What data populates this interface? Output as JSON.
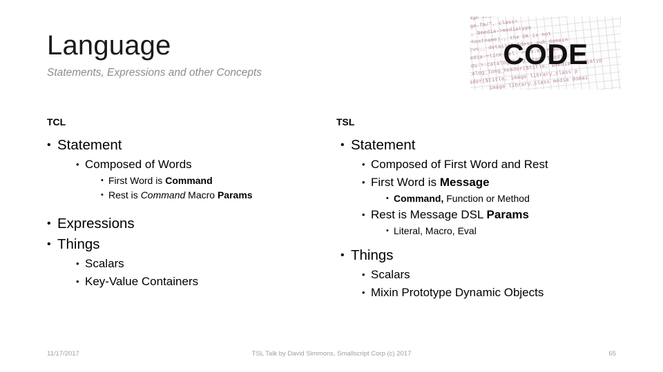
{
  "slide": {
    "title": "Language",
    "subtitle": "Statements, Expressions and other Concepts"
  },
  "code_image": {
    "word": "CODE",
    "alt": "code-collage-image",
    "code_lines": [
      ", new image tr_",
      "ctp://page.fm/\", class=",
      "r($title, $media->mediatype",
      "$media->hostname)., the OK is not",
      "es and cus__ details\",$desc_sub_domain",
      "type, media->link-rel  =-ss.main.edu-.",
      ".main.edu->-catalog_long_head, $media->med",
      "stn_catalog_long_header($title, $media->mediatyp",
      "    header($title, image library_class p",
      "            image library_class media domai"
    ],
    "text_color": "#b57a95"
  },
  "columns": [
    {
      "id": "tcl",
      "header": "TCL",
      "items": [
        {
          "level": 1,
          "text": "Statement"
        },
        {
          "level": 2,
          "text": "Composed of Words"
        },
        {
          "level": 3,
          "parts": [
            {
              "t": "First Word is ",
              "style": "normal"
            },
            {
              "t": "Command",
              "style": "bold"
            }
          ]
        },
        {
          "level": 3,
          "parts": [
            {
              "t": "Rest is ",
              "style": "normal"
            },
            {
              "t": "Command",
              "style": "italic"
            },
            {
              "t": " Macro ",
              "style": "normal"
            },
            {
              "t": "Params",
              "style": "bold"
            }
          ]
        },
        {
          "level": 1,
          "text": "Expressions",
          "gap": "large"
        },
        {
          "level": 1,
          "text": "Things"
        },
        {
          "level": 2,
          "text": "Scalars"
        },
        {
          "level": 2,
          "text": "Key-Value Containers"
        }
      ]
    },
    {
      "id": "tsl",
      "header": "TSL",
      "items": [
        {
          "level": 1,
          "text": "Statement"
        },
        {
          "level": 2,
          "text": "Composed of First Word and Rest"
        },
        {
          "level": 2,
          "parts": [
            {
              "t": "First Word is ",
              "style": "normal"
            },
            {
              "t": "Message",
              "style": "bold"
            }
          ]
        },
        {
          "level": 3,
          "parts": [
            {
              "t": "Command,",
              "style": "bold"
            },
            {
              "t": " Function or Method",
              "style": "normal"
            }
          ]
        },
        {
          "level": 2,
          "parts": [
            {
              "t": "Rest is Message DSL ",
              "style": "normal"
            },
            {
              "t": "Params",
              "style": "bold"
            }
          ]
        },
        {
          "level": 3,
          "text": "Literal, Macro, Eval"
        },
        {
          "level": 1,
          "text": "Things",
          "gap": "small"
        },
        {
          "level": 2,
          "text": "Scalars"
        },
        {
          "level": 2,
          "text": "Mixin Prototype Dynamic Objects"
        }
      ]
    }
  ],
  "footer": {
    "date": "11/17/2017",
    "center": "TSL Talk by David Simmons, Smallscript Corp (c) 2017",
    "page": "65"
  },
  "bullet_glyph": "•"
}
